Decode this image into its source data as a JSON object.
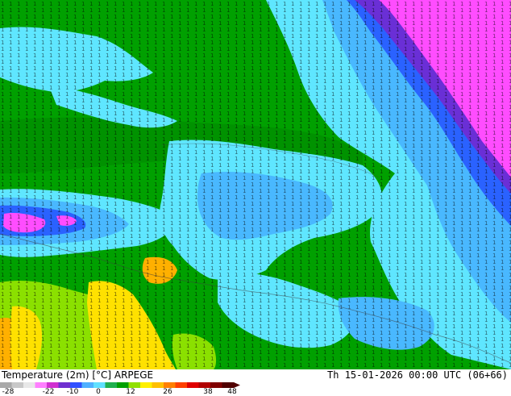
{
  "map": {
    "title_left": "Temperature (2m) [°C] ARPEGE",
    "title_right": "Th 15-01-2026 00:00 UTC (06+66)"
  },
  "colorbar": {
    "ticks": [
      "-28",
      "-22",
      "-10",
      "0",
      "12",
      "26",
      "38",
      "48"
    ],
    "colors": [
      "#a9a9a9",
      "#c8c8c8",
      "#e8e8e8",
      "#ff80ff",
      "#d030d0",
      "#7030d0",
      "#3050ff",
      "#50b0ff",
      "#60e0ff",
      "#20b050",
      "#00a000",
      "#90e000",
      "#fff000",
      "#ffc000",
      "#ff8000",
      "#ff4000",
      "#e00000",
      "#b00000",
      "#800000",
      "#500000"
    ]
  },
  "palette": {
    "green": "#00a000",
    "cyan": "#5fe6ff",
    "lightblue": "#49b8ff",
    "blue": "#2a62ff",
    "purple": "#6a2fd6",
    "magenta": "#ff4dff",
    "yellow": "#ffe100",
    "orange": "#ffb000",
    "lime": "#8be000",
    "darkgreen": "#008800"
  }
}
